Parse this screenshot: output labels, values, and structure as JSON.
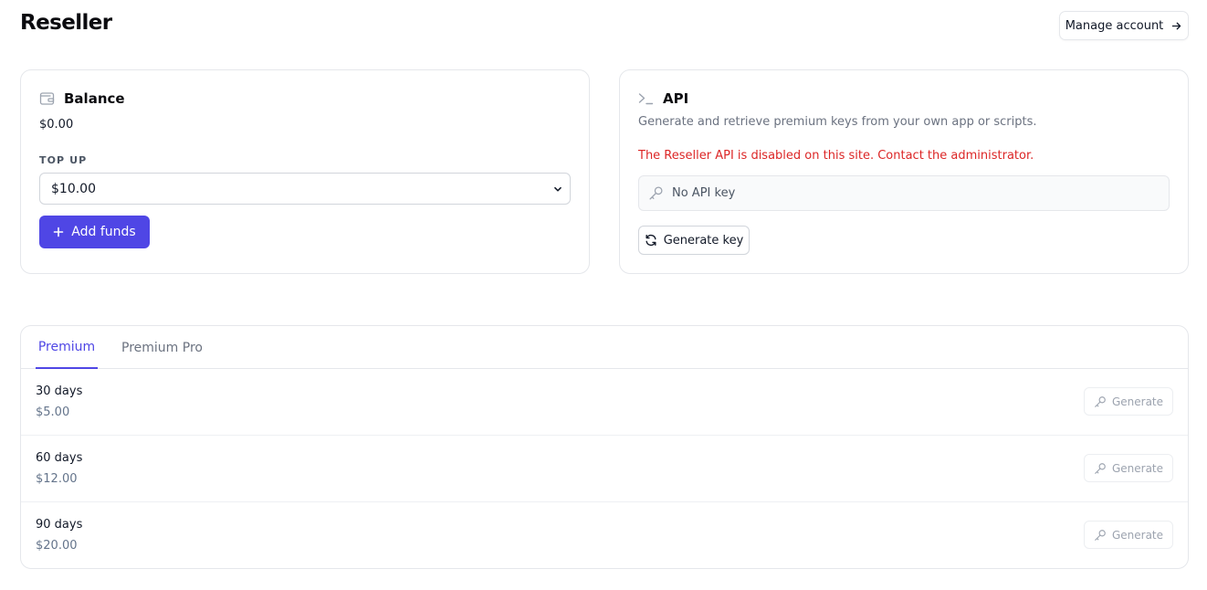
{
  "page": {
    "title": "Reseller"
  },
  "header": {
    "manage_account_label": "Manage account",
    "manage_account_icon": "arrow-right-icon"
  },
  "balance": {
    "title": "Balance",
    "icon": "wallet-icon",
    "amount": "$0.00",
    "topup_label": "TOP UP",
    "topup_selected": "$10.00",
    "add_funds_label": "Add funds"
  },
  "api": {
    "title": "API",
    "icon": "terminal-icon",
    "description": "Generate and retrieve premium keys from your own app or scripts.",
    "warning": "The Reseller API is disabled on this site. Contact the administrator.",
    "key_placeholder": "No API key",
    "generate_key_label": "Generate key"
  },
  "plans": {
    "tabs": [
      {
        "label": "Premium",
        "active": true
      },
      {
        "label": "Premium Pro",
        "active": false
      }
    ],
    "rows": [
      {
        "duration": "30 days",
        "price": "$5.00",
        "button": "Generate"
      },
      {
        "duration": "60 days",
        "price": "$12.00",
        "button": "Generate"
      },
      {
        "duration": "90 days",
        "price": "$20.00",
        "button": "Generate"
      }
    ]
  },
  "colors": {
    "accent": "#4f46e5",
    "warning": "#dc2626",
    "border": "#e5e7eb"
  }
}
